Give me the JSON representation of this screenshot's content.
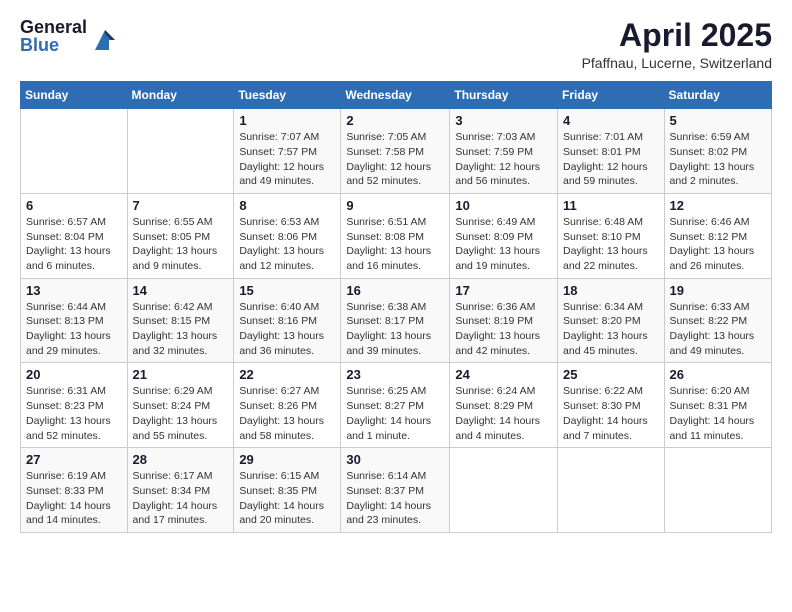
{
  "header": {
    "logo_general": "General",
    "logo_blue": "Blue",
    "title": "April 2025",
    "subtitle": "Pfaffnau, Lucerne, Switzerland"
  },
  "calendar": {
    "days_of_week": [
      "Sunday",
      "Monday",
      "Tuesday",
      "Wednesday",
      "Thursday",
      "Friday",
      "Saturday"
    ],
    "weeks": [
      [
        {
          "date": "",
          "info": ""
        },
        {
          "date": "",
          "info": ""
        },
        {
          "date": "1",
          "info": "Sunrise: 7:07 AM\nSunset: 7:57 PM\nDaylight: 12 hours and 49 minutes."
        },
        {
          "date": "2",
          "info": "Sunrise: 7:05 AM\nSunset: 7:58 PM\nDaylight: 12 hours and 52 minutes."
        },
        {
          "date": "3",
          "info": "Sunrise: 7:03 AM\nSunset: 7:59 PM\nDaylight: 12 hours and 56 minutes."
        },
        {
          "date": "4",
          "info": "Sunrise: 7:01 AM\nSunset: 8:01 PM\nDaylight: 12 hours and 59 minutes."
        },
        {
          "date": "5",
          "info": "Sunrise: 6:59 AM\nSunset: 8:02 PM\nDaylight: 13 hours and 2 minutes."
        }
      ],
      [
        {
          "date": "6",
          "info": "Sunrise: 6:57 AM\nSunset: 8:04 PM\nDaylight: 13 hours and 6 minutes."
        },
        {
          "date": "7",
          "info": "Sunrise: 6:55 AM\nSunset: 8:05 PM\nDaylight: 13 hours and 9 minutes."
        },
        {
          "date": "8",
          "info": "Sunrise: 6:53 AM\nSunset: 8:06 PM\nDaylight: 13 hours and 12 minutes."
        },
        {
          "date": "9",
          "info": "Sunrise: 6:51 AM\nSunset: 8:08 PM\nDaylight: 13 hours and 16 minutes."
        },
        {
          "date": "10",
          "info": "Sunrise: 6:49 AM\nSunset: 8:09 PM\nDaylight: 13 hours and 19 minutes."
        },
        {
          "date": "11",
          "info": "Sunrise: 6:48 AM\nSunset: 8:10 PM\nDaylight: 13 hours and 22 minutes."
        },
        {
          "date": "12",
          "info": "Sunrise: 6:46 AM\nSunset: 8:12 PM\nDaylight: 13 hours and 26 minutes."
        }
      ],
      [
        {
          "date": "13",
          "info": "Sunrise: 6:44 AM\nSunset: 8:13 PM\nDaylight: 13 hours and 29 minutes."
        },
        {
          "date": "14",
          "info": "Sunrise: 6:42 AM\nSunset: 8:15 PM\nDaylight: 13 hours and 32 minutes."
        },
        {
          "date": "15",
          "info": "Sunrise: 6:40 AM\nSunset: 8:16 PM\nDaylight: 13 hours and 36 minutes."
        },
        {
          "date": "16",
          "info": "Sunrise: 6:38 AM\nSunset: 8:17 PM\nDaylight: 13 hours and 39 minutes."
        },
        {
          "date": "17",
          "info": "Sunrise: 6:36 AM\nSunset: 8:19 PM\nDaylight: 13 hours and 42 minutes."
        },
        {
          "date": "18",
          "info": "Sunrise: 6:34 AM\nSunset: 8:20 PM\nDaylight: 13 hours and 45 minutes."
        },
        {
          "date": "19",
          "info": "Sunrise: 6:33 AM\nSunset: 8:22 PM\nDaylight: 13 hours and 49 minutes."
        }
      ],
      [
        {
          "date": "20",
          "info": "Sunrise: 6:31 AM\nSunset: 8:23 PM\nDaylight: 13 hours and 52 minutes."
        },
        {
          "date": "21",
          "info": "Sunrise: 6:29 AM\nSunset: 8:24 PM\nDaylight: 13 hours and 55 minutes."
        },
        {
          "date": "22",
          "info": "Sunrise: 6:27 AM\nSunset: 8:26 PM\nDaylight: 13 hours and 58 minutes."
        },
        {
          "date": "23",
          "info": "Sunrise: 6:25 AM\nSunset: 8:27 PM\nDaylight: 14 hours and 1 minute."
        },
        {
          "date": "24",
          "info": "Sunrise: 6:24 AM\nSunset: 8:29 PM\nDaylight: 14 hours and 4 minutes."
        },
        {
          "date": "25",
          "info": "Sunrise: 6:22 AM\nSunset: 8:30 PM\nDaylight: 14 hours and 7 minutes."
        },
        {
          "date": "26",
          "info": "Sunrise: 6:20 AM\nSunset: 8:31 PM\nDaylight: 14 hours and 11 minutes."
        }
      ],
      [
        {
          "date": "27",
          "info": "Sunrise: 6:19 AM\nSunset: 8:33 PM\nDaylight: 14 hours and 14 minutes."
        },
        {
          "date": "28",
          "info": "Sunrise: 6:17 AM\nSunset: 8:34 PM\nDaylight: 14 hours and 17 minutes."
        },
        {
          "date": "29",
          "info": "Sunrise: 6:15 AM\nSunset: 8:35 PM\nDaylight: 14 hours and 20 minutes."
        },
        {
          "date": "30",
          "info": "Sunrise: 6:14 AM\nSunset: 8:37 PM\nDaylight: 14 hours and 23 minutes."
        },
        {
          "date": "",
          "info": ""
        },
        {
          "date": "",
          "info": ""
        },
        {
          "date": "",
          "info": ""
        }
      ]
    ]
  }
}
